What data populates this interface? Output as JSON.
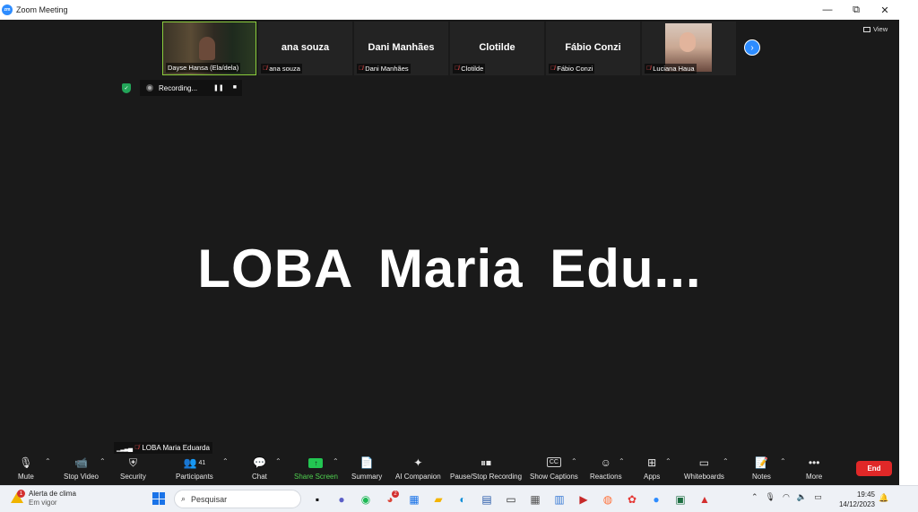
{
  "window": {
    "title": "Zoom Meeting",
    "minimize": "—",
    "maximize": "⧉",
    "close": "✕"
  },
  "gallery": {
    "participants": [
      {
        "big": "",
        "label": "Dayse Hansa (Ela/dela)",
        "video": true
      },
      {
        "big": "ana souza",
        "label": "ana souza"
      },
      {
        "big": "Dani Manhães",
        "label": "Dani Manhães"
      },
      {
        "big": "Clotilde",
        "label": "Clotilde"
      },
      {
        "big": "Fábio Conzi",
        "label": "Fábio Conzi"
      },
      {
        "big": "",
        "label": "Luciana Haua",
        "video": true
      }
    ],
    "next_label": "›",
    "view_label": "View"
  },
  "recording": {
    "label": "Recording...",
    "pause": "❚❚",
    "stop": "■"
  },
  "speaker": {
    "name": "LOBA  Maria  Edu..."
  },
  "self": {
    "label": "LOBA Maria Eduarda"
  },
  "toolbar": {
    "mute": "Mute",
    "stop_video": "Stop Video",
    "security": "Security",
    "participants": "Participants",
    "participants_count": "41",
    "chat": "Chat",
    "share_screen": "Share Screen",
    "summary": "Summary",
    "ai_companion": "AI Companion",
    "pause_stop_recording": "Pause/Stop Recording",
    "show_captions": "Show Captions",
    "cc": "CC",
    "reactions": "Reactions",
    "apps": "Apps",
    "whiteboards": "Whiteboards",
    "notes": "Notes",
    "more": "More",
    "end": "End"
  },
  "taskbar": {
    "weather_title": "Alerta de clima",
    "weather_sub": "Em vigor",
    "weather_badge": "1",
    "search_placeholder": "Pesquisar",
    "chrome_badge": "2",
    "time": "19:45",
    "date": "14/12/2023"
  },
  "colors": {
    "accent": "#2d8cff",
    "end": "#e02828",
    "share": "#23c552",
    "meeting_bg": "#1a1a1a"
  }
}
